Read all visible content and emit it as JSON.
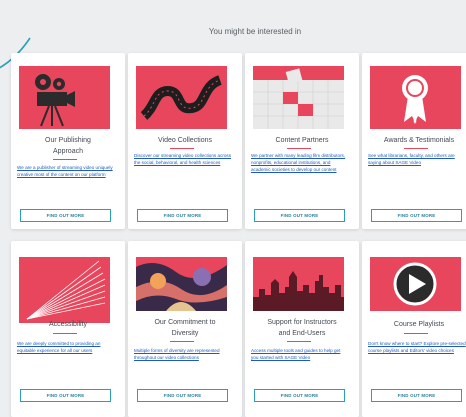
{
  "section": {
    "heading": "You might be interested in",
    "accent_color": "#e8465c",
    "button_color": "#2a9fb8"
  },
  "cards": [
    {
      "title": "Our Publishing Approach",
      "title_lines": [
        "Our Publishing",
        "Approach"
      ],
      "description": "We are a publisher of streaming video uniquely creative most of the content on our platform",
      "button": "FIND OUT MORE",
      "icon": "film-camera-icon"
    },
    {
      "title": "Video Collections",
      "title_lines": [
        "Video Collections"
      ],
      "description": "Discover our streaming video collections across the social, behavioral, and health sciences",
      "button": "FIND OUT MORE",
      "icon": "film-strip-icon"
    },
    {
      "title": "Content Partners",
      "title_lines": [
        "Content Partners"
      ],
      "description": "We partner with many leading film distributors, nonprofits, educational institutions, and academic societies to develop our content",
      "button": "FIND OUT MORE",
      "icon": "puzzle-icon"
    },
    {
      "title": "Awards & Testimonials",
      "title_lines": [
        "Awards & Testimonials"
      ],
      "description": "See what librarians, faculty, and others are saying about SAGE Video",
      "button": "FIND OUT MORE",
      "icon": "award-ribbon-icon"
    },
    {
      "title": "Accessibility",
      "title_lines": [
        "Accessibility"
      ],
      "description": "We are deeply committed to providing an equitable experience for all our users",
      "button": "FIND OUT MORE",
      "icon": "light-rays-icon"
    },
    {
      "title": "Our Commitment to Diversity",
      "title_lines": [
        "Our Commitment to",
        "Diversity"
      ],
      "description": "Multiple forms of diversity are represented throughout our video collections",
      "button": "FIND OUT MORE",
      "icon": "diversity-artwork-icon"
    },
    {
      "title": "Support for Instructors and End-Users",
      "title_lines": [
        "Support for Instructors",
        "and End-Users"
      ],
      "description": "Access multiple tools and guides to help get you started with SAGE Video",
      "button": "FIND OUT MORE",
      "icon": "city-skyline-icon"
    },
    {
      "title": "Course Playlists",
      "title_lines": [
        "Course Playlists"
      ],
      "description": "Don't know where to start? Explore pre-selected course playlists and Editors' video choices",
      "button": "FIND OUT MORE",
      "icon": "play-button-icon"
    }
  ]
}
